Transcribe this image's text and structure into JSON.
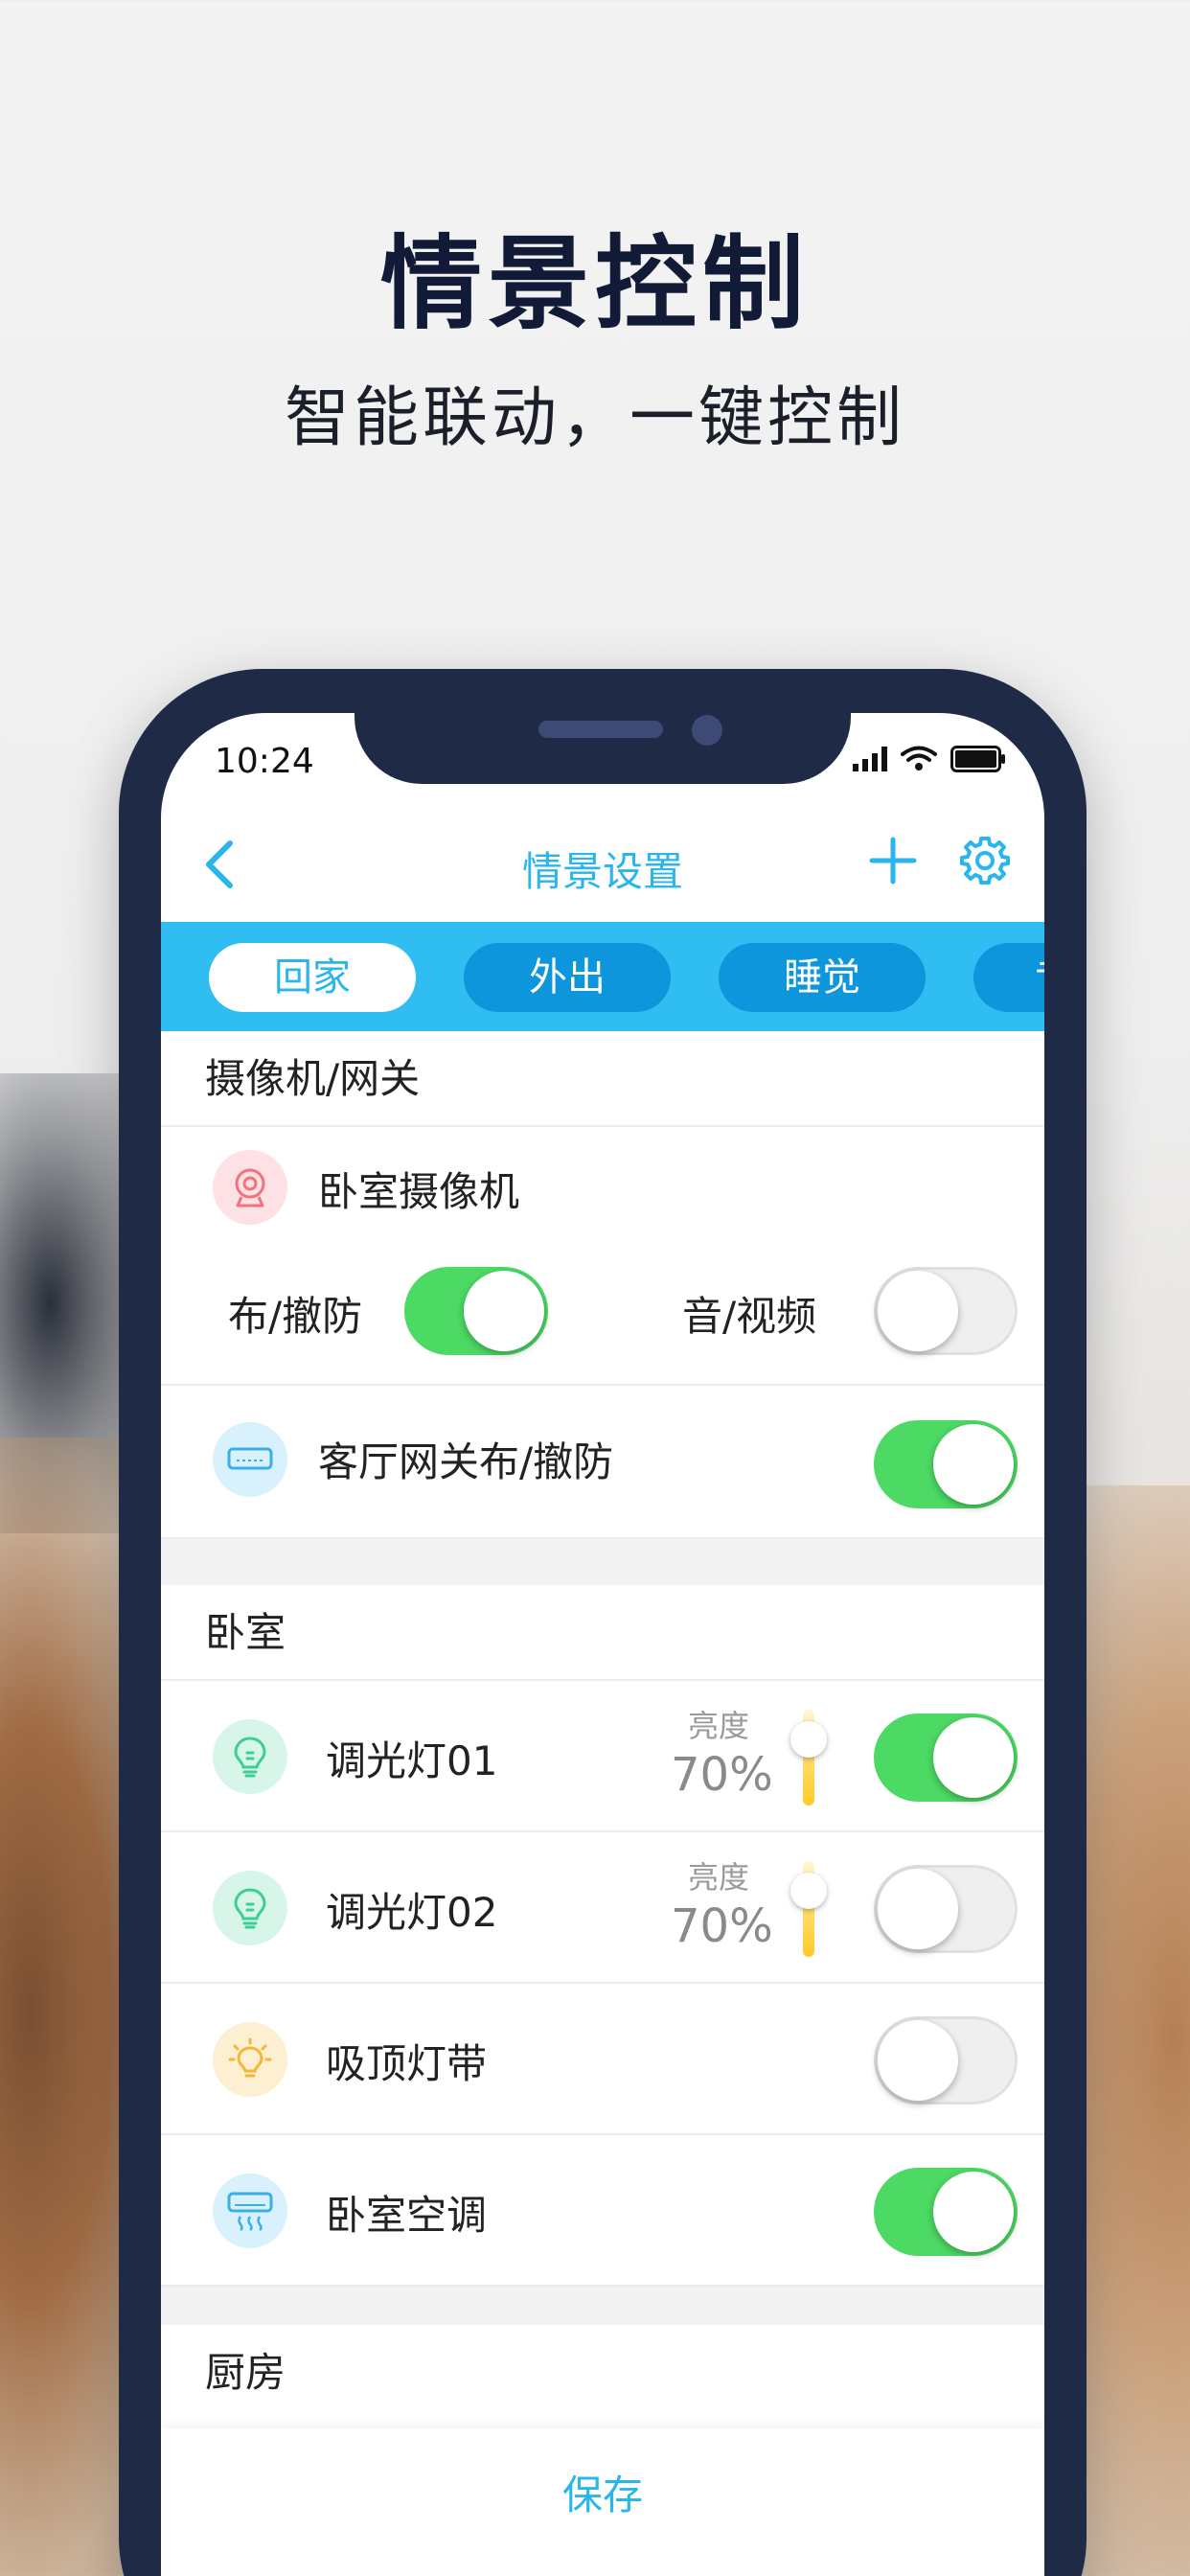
{
  "hero": {
    "title": "情景控制",
    "subtitle": "智能联动，一键控制"
  },
  "status_bar": {
    "time": "10:24"
  },
  "nav": {
    "title": "情景设置"
  },
  "tabs": [
    {
      "label": "回家",
      "active": true
    },
    {
      "label": "外出",
      "active": false
    },
    {
      "label": "睡觉",
      "active": false
    },
    {
      "label": "专",
      "active": false
    }
  ],
  "sections": {
    "camera": {
      "header": "摄像机/网关",
      "camera_name": "卧室摄像机",
      "arm_label": "布/撤防",
      "arm_on": true,
      "av_label": "音/视频",
      "av_on": false,
      "gateway_label": "客厅网关布/撤防",
      "gateway_on": true
    },
    "bedroom": {
      "header": "卧室",
      "devices": [
        {
          "name": "调光灯01",
          "brightness_label": "亮度",
          "brightness": "70%",
          "on": true
        },
        {
          "name": "调光灯02",
          "brightness_label": "亮度",
          "brightness": "70%",
          "on": false
        },
        {
          "name": "吸顶灯带",
          "on": false
        },
        {
          "name": "卧室空调",
          "on": true
        }
      ]
    },
    "kitchen": {
      "header": "厨房"
    }
  },
  "footer": {
    "save_label": "保存"
  },
  "colors": {
    "accent": "#29b6ec",
    "tab_bar": "#2fbdf2",
    "tab_inactive": "#0d96db",
    "toggle_on": "#4cd964",
    "frame": "#1f2a47"
  },
  "icons": {
    "camera": "webcam-icon",
    "gateway": "gateway-icon",
    "dimmer": "bulb-icon",
    "ceiling": "ceiling-light-icon",
    "ac": "air-conditioner-icon"
  }
}
